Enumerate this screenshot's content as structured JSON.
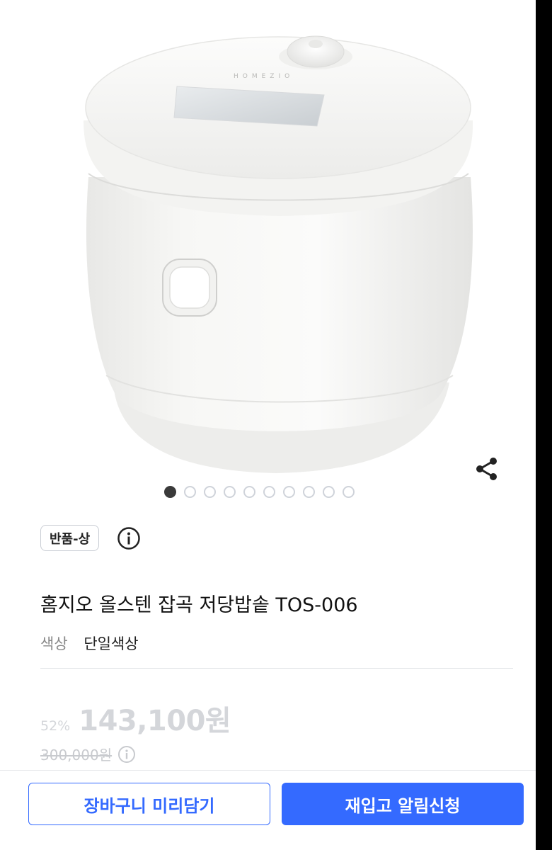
{
  "product": {
    "image_alt": "rice-cooker-image",
    "carousel": {
      "total": 10,
      "active_index": 0
    },
    "badge": "반품-상",
    "title": "홈지오 올스텐 잡곡 저당밥솥 TOS-006",
    "option": {
      "label": "색상",
      "value": "단일색상"
    },
    "price": {
      "discount_rate": "52%",
      "sale_price": "143,100원",
      "original_price": "300,000원"
    }
  },
  "actions": {
    "cart_label": "장바구니 미리담기",
    "notify_label": "재입고 알림신청"
  },
  "colors": {
    "accent": "#346aff",
    "text_primary": "#111111",
    "text_muted": "#888888",
    "disabled_price": "#d4d6da"
  },
  "icons": [
    "share-icon",
    "info-icon"
  ]
}
